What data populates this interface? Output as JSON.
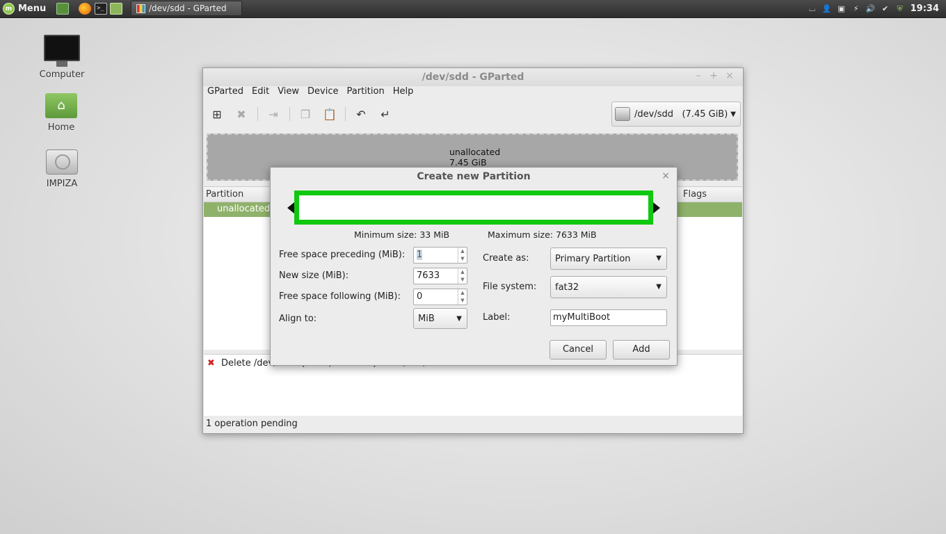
{
  "panel": {
    "menu_label": "Menu",
    "task_label": "/dev/sdd - GParted",
    "clock": "19:34"
  },
  "desktop": {
    "icons": [
      {
        "label": "Computer"
      },
      {
        "label": "Home"
      },
      {
        "label": "IMPIZA"
      }
    ]
  },
  "window": {
    "title": "/dev/sdd - GParted",
    "menu": [
      "GParted",
      "Edit",
      "View",
      "Device",
      "Partition",
      "Help"
    ],
    "device": {
      "name": "/dev/sdd",
      "size": "(7.45 GiB)"
    },
    "disk_map": {
      "label": "unallocated",
      "size": "7.45 GiB"
    },
    "table": {
      "headers": {
        "partition": "Partition",
        "flags": "Flags"
      },
      "rows": [
        {
          "partition": "unallocated"
        }
      ]
    },
    "pending_operation": "Delete /dev/sdd1 (fat32, 7.45 GiB) from /dev/sdd",
    "status": "1 operation pending"
  },
  "dialog": {
    "title": "Create new Partition",
    "min_size": "Minimum size: 33 MiB",
    "max_size": "Maximum size: 7633 MiB",
    "fields": {
      "preceding_label": "Free space preceding (MiB):",
      "preceding_value": "1",
      "new_size_label": "New size (MiB):",
      "new_size_value": "7633",
      "following_label": "Free space following (MiB):",
      "following_value": "0",
      "align_label": "Align to:",
      "align_value": "MiB",
      "create_as_label": "Create as:",
      "create_as_value": "Primary Partition",
      "filesystem_label": "File system:",
      "filesystem_value": "fat32",
      "label_label": "Label:",
      "label_value": "myMultiBoot"
    },
    "buttons": {
      "cancel": "Cancel",
      "add": "Add"
    }
  }
}
